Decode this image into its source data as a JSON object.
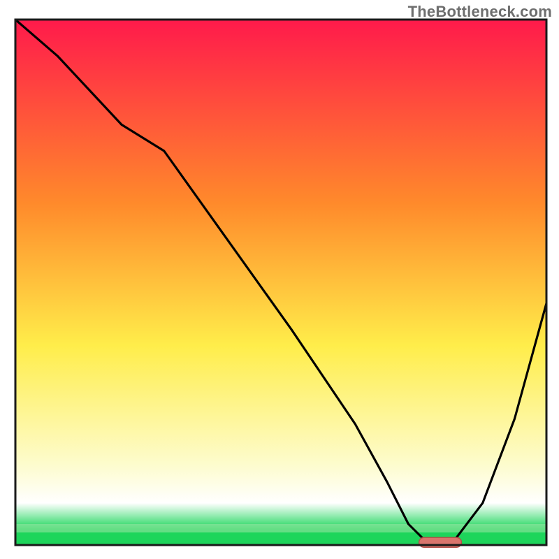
{
  "watermark": "TheBottleneck.com",
  "colors": {
    "gradient_top": "#ff1a4b",
    "gradient_mid1": "#ff8a2b",
    "gradient_mid2": "#ffed4a",
    "gradient_mid3": "#fdfccf",
    "gradient_bottom_white": "#ffffff",
    "gradient_green": "#1dd65b",
    "curve": "#000000",
    "marker_fill": "#d9746c",
    "marker_stroke": "#b64f4a",
    "frame": "#1a1a1a"
  },
  "chart_data": {
    "type": "line",
    "title": "",
    "xlabel": "",
    "ylabel": "",
    "xlim": [
      0,
      100
    ],
    "ylim": [
      0,
      100
    ],
    "grid": false,
    "series": [
      {
        "name": "bottleneck-curve",
        "x": [
          0,
          8,
          20,
          28,
          40,
          52,
          64,
          70,
          74,
          78,
          82,
          88,
          94,
          100
        ],
        "y": [
          100,
          93,
          80,
          75,
          58,
          41,
          23,
          12,
          4,
          0,
          0,
          8,
          24,
          46
        ]
      }
    ],
    "annotations": [
      {
        "name": "optimal-marker",
        "shape": "capsule",
        "x_start": 76,
        "x_end": 84,
        "y": 0.5
      }
    ],
    "background_gradient_stops": [
      {
        "pos": 0.0,
        "meaning": "severe-bottleneck",
        "color": "#ff1a4b"
      },
      {
        "pos": 0.35,
        "meaning": "high-bottleneck",
        "color": "#ff8a2b"
      },
      {
        "pos": 0.62,
        "meaning": "moderate",
        "color": "#ffed4a"
      },
      {
        "pos": 0.85,
        "meaning": "low",
        "color": "#fdfccf"
      },
      {
        "pos": 0.97,
        "meaning": "optimal",
        "color": "#1dd65b"
      }
    ]
  }
}
